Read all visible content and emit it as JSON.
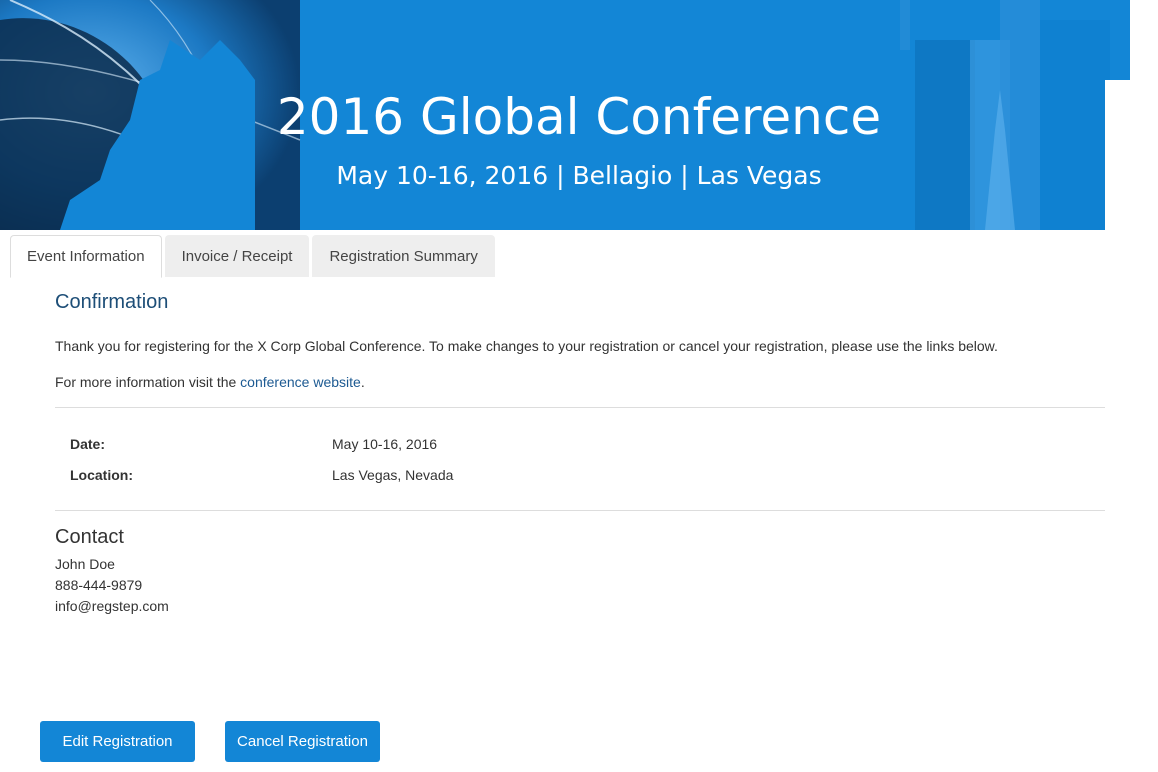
{
  "banner": {
    "title": "2016 Global Conference",
    "subtitle": "May 10-16, 2016 | Bellagio | Las Vegas",
    "bg_color": "#1386d6"
  },
  "tabs": [
    {
      "label": "Event Information",
      "active": true
    },
    {
      "label": "Invoice / Receipt",
      "active": false
    },
    {
      "label": "Registration Summary",
      "active": false
    }
  ],
  "confirmation": {
    "heading": "Confirmation",
    "message": "Thank you for registering for the X Corp Global Conference. To make changes to your registration or cancel your registration, please use the links below.",
    "more_info_prefix": "For more information visit the ",
    "more_info_link": "conference website",
    "more_info_suffix": "."
  },
  "details": {
    "date_label": "Date:",
    "date_value": "May 10-16, 2016",
    "location_label": "Location:",
    "location_value": "Las Vegas, Nevada"
  },
  "contact": {
    "heading": "Contact",
    "name": "John Doe",
    "phone": "888-444-9879",
    "email": "info@regstep.com"
  },
  "actions": {
    "edit_label": "Edit Registration",
    "cancel_label": "Cancel Registration"
  },
  "colors": {
    "accent": "#1386d6",
    "heading_blue": "#1d4e77"
  }
}
